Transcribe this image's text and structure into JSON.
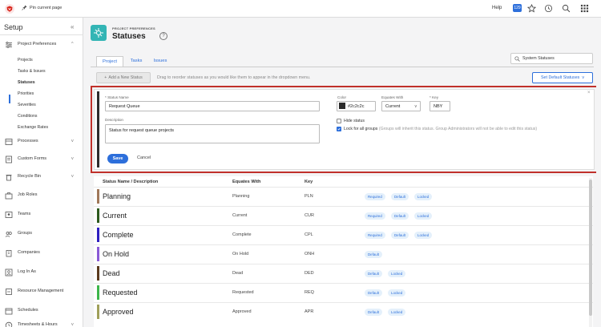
{
  "topbar": {
    "pin_label": "Pin current page",
    "help_label": "Help",
    "badge_count": "129",
    "icons": [
      "star-icon",
      "history-icon",
      "search-icon",
      "apps-grid-icon"
    ]
  },
  "sidebar": {
    "title": "Setup",
    "collapse_symbol": "«",
    "sections": [
      {
        "label": "Project Preferences",
        "icon": "sliders-icon",
        "expanded": true
      },
      {
        "label": "Processes",
        "icon": "processes-icon",
        "expanded": false
      },
      {
        "label": "Custom Forms",
        "icon": "form-icon",
        "expanded": false
      },
      {
        "label": "Recycle Bin",
        "icon": "trash-icon",
        "expanded": false
      },
      {
        "label": "Job Roles",
        "icon": "job-roles-icon"
      },
      {
        "label": "Teams",
        "icon": "teams-icon"
      },
      {
        "label": "Groups",
        "icon": "groups-icon"
      },
      {
        "label": "Companies",
        "icon": "companies-icon"
      },
      {
        "label": "Log In As",
        "icon": "login-icon"
      },
      {
        "label": "Resource Management",
        "icon": "resource-icon"
      },
      {
        "label": "Schedules",
        "icon": "calendar-icon"
      },
      {
        "label": "Timesheets & Hours",
        "icon": "clock-icon",
        "expanded": false
      }
    ],
    "sub_items": [
      "Projects",
      "Tasks & Issues",
      "Statuses",
      "Priorities",
      "Severities",
      "Conditions",
      "Exchange Rates"
    ],
    "active_sub": "Statuses"
  },
  "header": {
    "kicker": "PROJECT PREFERENCES",
    "title": "Statuses",
    "help_symbol": "?"
  },
  "tabs": [
    "Project",
    "Tasks",
    "Issues"
  ],
  "active_tab": "Project",
  "search": {
    "value": "System Statuses"
  },
  "toolbar": {
    "new_status_label": "Add a New Status",
    "hint": "Drag to reorder statuses as you would like them to appear in the dropdown menu.",
    "default_label": "Set Default Statuses"
  },
  "form": {
    "status_name_label": "Status Name",
    "status_name_value": "Request Queue",
    "description_label": "Description",
    "description_value": "Status for request queue projects",
    "color_label": "Color",
    "color_value": "#2c2c2c",
    "equates_label": "Equates With",
    "equates_value": "Current",
    "key_label": "Key",
    "key_value": "NBY",
    "hide_label": "Hide status",
    "hide_checked": false,
    "lock_label": "Lock for all groups",
    "lock_note": "(Groups will inherit this status. Group Administrators will not be able to edit this status)",
    "lock_checked": true,
    "save_label": "Save",
    "cancel_label": "Cancel",
    "required_marker": "*",
    "close_symbol": "×"
  },
  "table": {
    "headers": {
      "name": "Status Name / Description",
      "equates": "Equates With",
      "key": "Key"
    },
    "rows": [
      {
        "name": "Planning",
        "equates": "Planning",
        "key": "PLN",
        "color": "#a0785a",
        "tags": [
          "Required",
          "Default",
          "Locked"
        ]
      },
      {
        "name": "Current",
        "equates": "Current",
        "key": "CUR",
        "color": "#2d5a1e",
        "tags": [
          "Required",
          "Default",
          "Locked"
        ]
      },
      {
        "name": "Complete",
        "equates": "Complete",
        "key": "CPL",
        "color": "#2e1fc0",
        "tags": [
          "Required",
          "Default",
          "Locked"
        ]
      },
      {
        "name": "On Hold",
        "equates": "On Hold",
        "key": "ONH",
        "color": "#8a5ad6",
        "tags": [
          "Default"
        ]
      },
      {
        "name": "Dead",
        "equates": "Dead",
        "key": "DED",
        "color": "#5a3a1e",
        "tags": [
          "Default",
          "Locked"
        ]
      },
      {
        "name": "Requested",
        "equates": "Requested",
        "key": "REQ",
        "color": "#3cb54a",
        "tags": [
          "Default",
          "Locked"
        ]
      },
      {
        "name": "Approved",
        "equates": "Approved",
        "key": "APR",
        "color": "#a0a05a",
        "tags": [
          "Default",
          "Locked"
        ]
      }
    ]
  },
  "colors": {
    "accent": "#2d6fdb",
    "highlight_outline": "#c0302a",
    "header_icon": "#33b5b5"
  }
}
